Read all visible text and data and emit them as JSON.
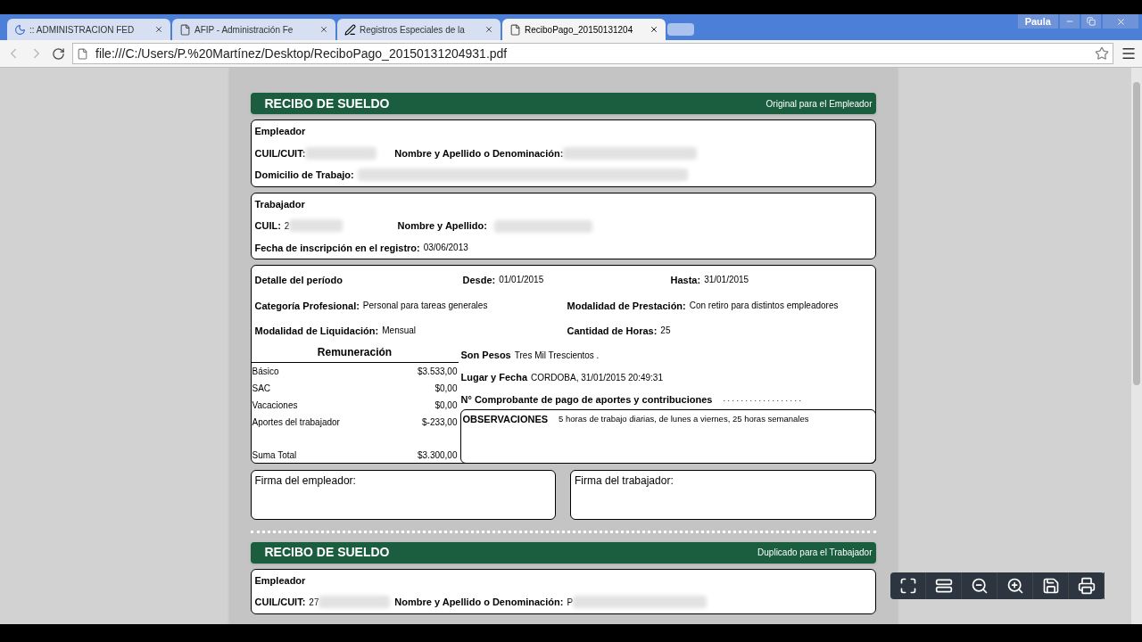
{
  "browser": {
    "tabs": [
      {
        "title": ":: ADMINISTRACION FED",
        "kind": "moon",
        "selected": false
      },
      {
        "title": "AFIP - Administración Fe",
        "kind": "page",
        "selected": false
      },
      {
        "title": "Registros Especiales de la",
        "kind": "pen",
        "selected": false
      },
      {
        "title": "ReciboPago_20150131204",
        "kind": "page",
        "selected": true
      }
    ],
    "user": "Paula",
    "url": "file:///C:/Users/P.%20Martínez/Desktop/ReciboPago_20150131204931.pdf"
  },
  "receipts": [
    {
      "title": "RECIBO DE SUELDO",
      "copy": "Original para el Empleador",
      "employer": {
        "heading": "Empleador",
        "cuit_label": "CUIL/CUIT:",
        "name_label": "Nombre y Apellido o Denominación:",
        "address_label": "Domicilio de Trabajo:"
      },
      "worker": {
        "heading": "Trabajador",
        "cuil_label": "CUIL:",
        "cuil": "2",
        "name_label": "Nombre y Apellido:",
        "date_label": "Fecha de inscripción en el registro:",
        "date": "03/06/2013"
      },
      "period": {
        "heading": "Detalle del período",
        "from_label": "Desde:",
        "from": "01/01/2015",
        "to_label": "Hasta:",
        "to": "31/01/2015",
        "category_label": "Categoría Profesional:",
        "category": "Personal para tareas generales",
        "mode_label": "Modalidad de Prestación:",
        "mode": "Con retiro para distintos empleadores",
        "liq_label": "Modalidad de Liquidación:",
        "liq": "Mensual",
        "hours_label": "Cantidad de Horas:",
        "hours": "25"
      },
      "pay": {
        "heading": "Remuneración",
        "rows": [
          {
            "label": "Básico",
            "amount": "$3.533,00"
          },
          {
            "label": "SAC",
            "amount": "$0,00"
          },
          {
            "label": "Vacaciones",
            "amount": "$0,00"
          },
          {
            "label": "Aportes del trabajador",
            "amount": "$-233,00"
          }
        ],
        "total_label": "Suma Total",
        "total": "$3.300,00"
      },
      "words_label": "Son Pesos",
      "words": "Tres Mil Trescientos .",
      "place_label": "Lugar y Fecha",
      "place": "CORDOBA, 31/01/2015 20:49:31",
      "voucher_label": "N° Comprobante de pago de aportes y contribuciones",
      "voucher": ". . . . . . . . . . . . . . . . . .",
      "obs_label": "OBSERVACIONES",
      "obs": "5 horas de trabajo diarias, de lunes a viernes, 25 horas semanales",
      "sign_employer": "Firma del empleador:",
      "sign_worker": "Firma del trabajador:"
    },
    {
      "title": "RECIBO DE SUELDO",
      "copy": "Duplicado para el Trabajador",
      "employer": {
        "heading": "Empleador",
        "cuit_label": "CUIL/CUIT:",
        "cuit": "27",
        "name_label": "Nombre y Apellido o Denominación:",
        "name": "P"
      }
    }
  ]
}
